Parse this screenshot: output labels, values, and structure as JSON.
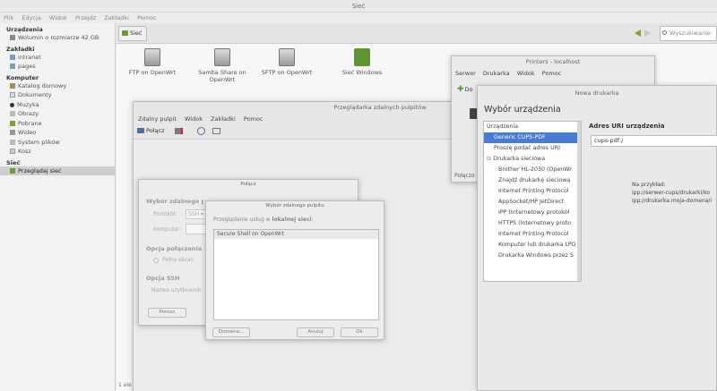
{
  "title": "Sieć",
  "menu": [
    "Plik",
    "Edycja",
    "Widok",
    "Przejdź",
    "Zakładki",
    "Pomoc"
  ],
  "toolbar": {
    "location": "Sieć",
    "search_placeholder": "Wyszukiwanie"
  },
  "sidebar": {
    "sections": [
      {
        "head": "Urządzenia",
        "items": [
          {
            "label": "Wolumin o rozmiarze 42 GB",
            "icon": "drive-icon"
          }
        ]
      },
      {
        "head": "Zakładki",
        "items": [
          {
            "label": "intranet",
            "icon": "folder-icon"
          },
          {
            "label": "pages",
            "icon": "folder-icon"
          }
        ]
      },
      {
        "head": "Komputer",
        "items": [
          {
            "label": "Katalog domowy",
            "icon": "home-icon"
          },
          {
            "label": "Dokumenty",
            "icon": "documents-icon"
          },
          {
            "label": "Muzyka",
            "icon": "music-icon"
          },
          {
            "label": "Obrazy",
            "icon": "pictures-icon"
          },
          {
            "label": "Pobrane",
            "icon": "download-icon"
          },
          {
            "label": "Wideo",
            "icon": "video-icon"
          },
          {
            "label": "System plików",
            "icon": "filesystem-icon"
          },
          {
            "label": "Kosz",
            "icon": "trash-icon"
          }
        ]
      },
      {
        "head": "Sieć",
        "items": [
          {
            "label": "Przeglądaj sieć",
            "icon": "network-icon",
            "selected": true
          }
        ]
      }
    ]
  },
  "shares": [
    "FTP on OpenWrt",
    "Samba Share on OpenWrt",
    "SFTP on OpenWrt",
    "Sieć Windows"
  ],
  "status": "1 ele",
  "remote_viewer": {
    "title": "Przeglądarka zdalnych pulpitów",
    "menu": [
      "Zdalny pulpit",
      "Widok",
      "Zakładki",
      "Pomoc"
    ],
    "connect_label": "Połącz"
  },
  "connect_dialog": {
    "title": "Połącz",
    "section": "Wybór zdalnego pulpitu",
    "protocol_label": "Protokół:",
    "protocol_value": "SSH",
    "computer_label": "Komputer:",
    "options_head": "Opcja połączenia",
    "fullscreen": "Pełny ekran",
    "ssh_head": "Opcja SSH",
    "username_label": "Nazwa użytkownik",
    "help": "Pomoc"
  },
  "select_dialog": {
    "title": "Wybór zdalnego pulpitu",
    "info_prefix": "Przeglądanie usług w",
    "info_bold": "lokalnej sieci",
    "info_suffix": ":",
    "items": [
      "Secure Shell on OpenWrt"
    ],
    "domain": "Domena...",
    "cancel": "Anuluj",
    "ok": "Ok"
  },
  "printers": {
    "title": "Printers - localhost",
    "menu": [
      "Serwer",
      "Drukarka",
      "Widok",
      "Pomoc"
    ],
    "add": "Do",
    "status": "Połączo"
  },
  "new_printer": {
    "title": "Nowa drukarka",
    "heading": "Wybór urządzenia",
    "devices": [
      {
        "label": "Urządzenia",
        "type": "head"
      },
      {
        "label": "Generic CUPS-PDF",
        "type": "sel"
      },
      {
        "label": "Proszę podać adres URI",
        "type": "item"
      },
      {
        "label": "Drukarka sieciowa",
        "type": "head2"
      },
      {
        "label": "Brother HL-2030 (OpenWr",
        "type": "sub"
      },
      {
        "label": "Znajdź drukarkę sieciową",
        "type": "sub"
      },
      {
        "label": "Internet Printing Protocol",
        "type": "sub"
      },
      {
        "label": "AppSocket/HP JetDirect",
        "type": "sub"
      },
      {
        "label": "IPP (Internetowy protokół",
        "type": "sub"
      },
      {
        "label": "HTTPS (Internetowy proto",
        "type": "sub"
      },
      {
        "label": "Internet Printing Protocol",
        "type": "sub"
      },
      {
        "label": "Komputer lub drukarka LPD",
        "type": "sub"
      },
      {
        "label": "Drukarka Windows przez S",
        "type": "sub"
      }
    ],
    "uri_label": "Adres URI urządzenia",
    "uri_value": "cups-pdf:/",
    "example_head": "Na przykład:",
    "example1": "ipp://serwer-cups/drukarki/ko",
    "example2": "ipp://drukarka.moja-domena/i"
  }
}
